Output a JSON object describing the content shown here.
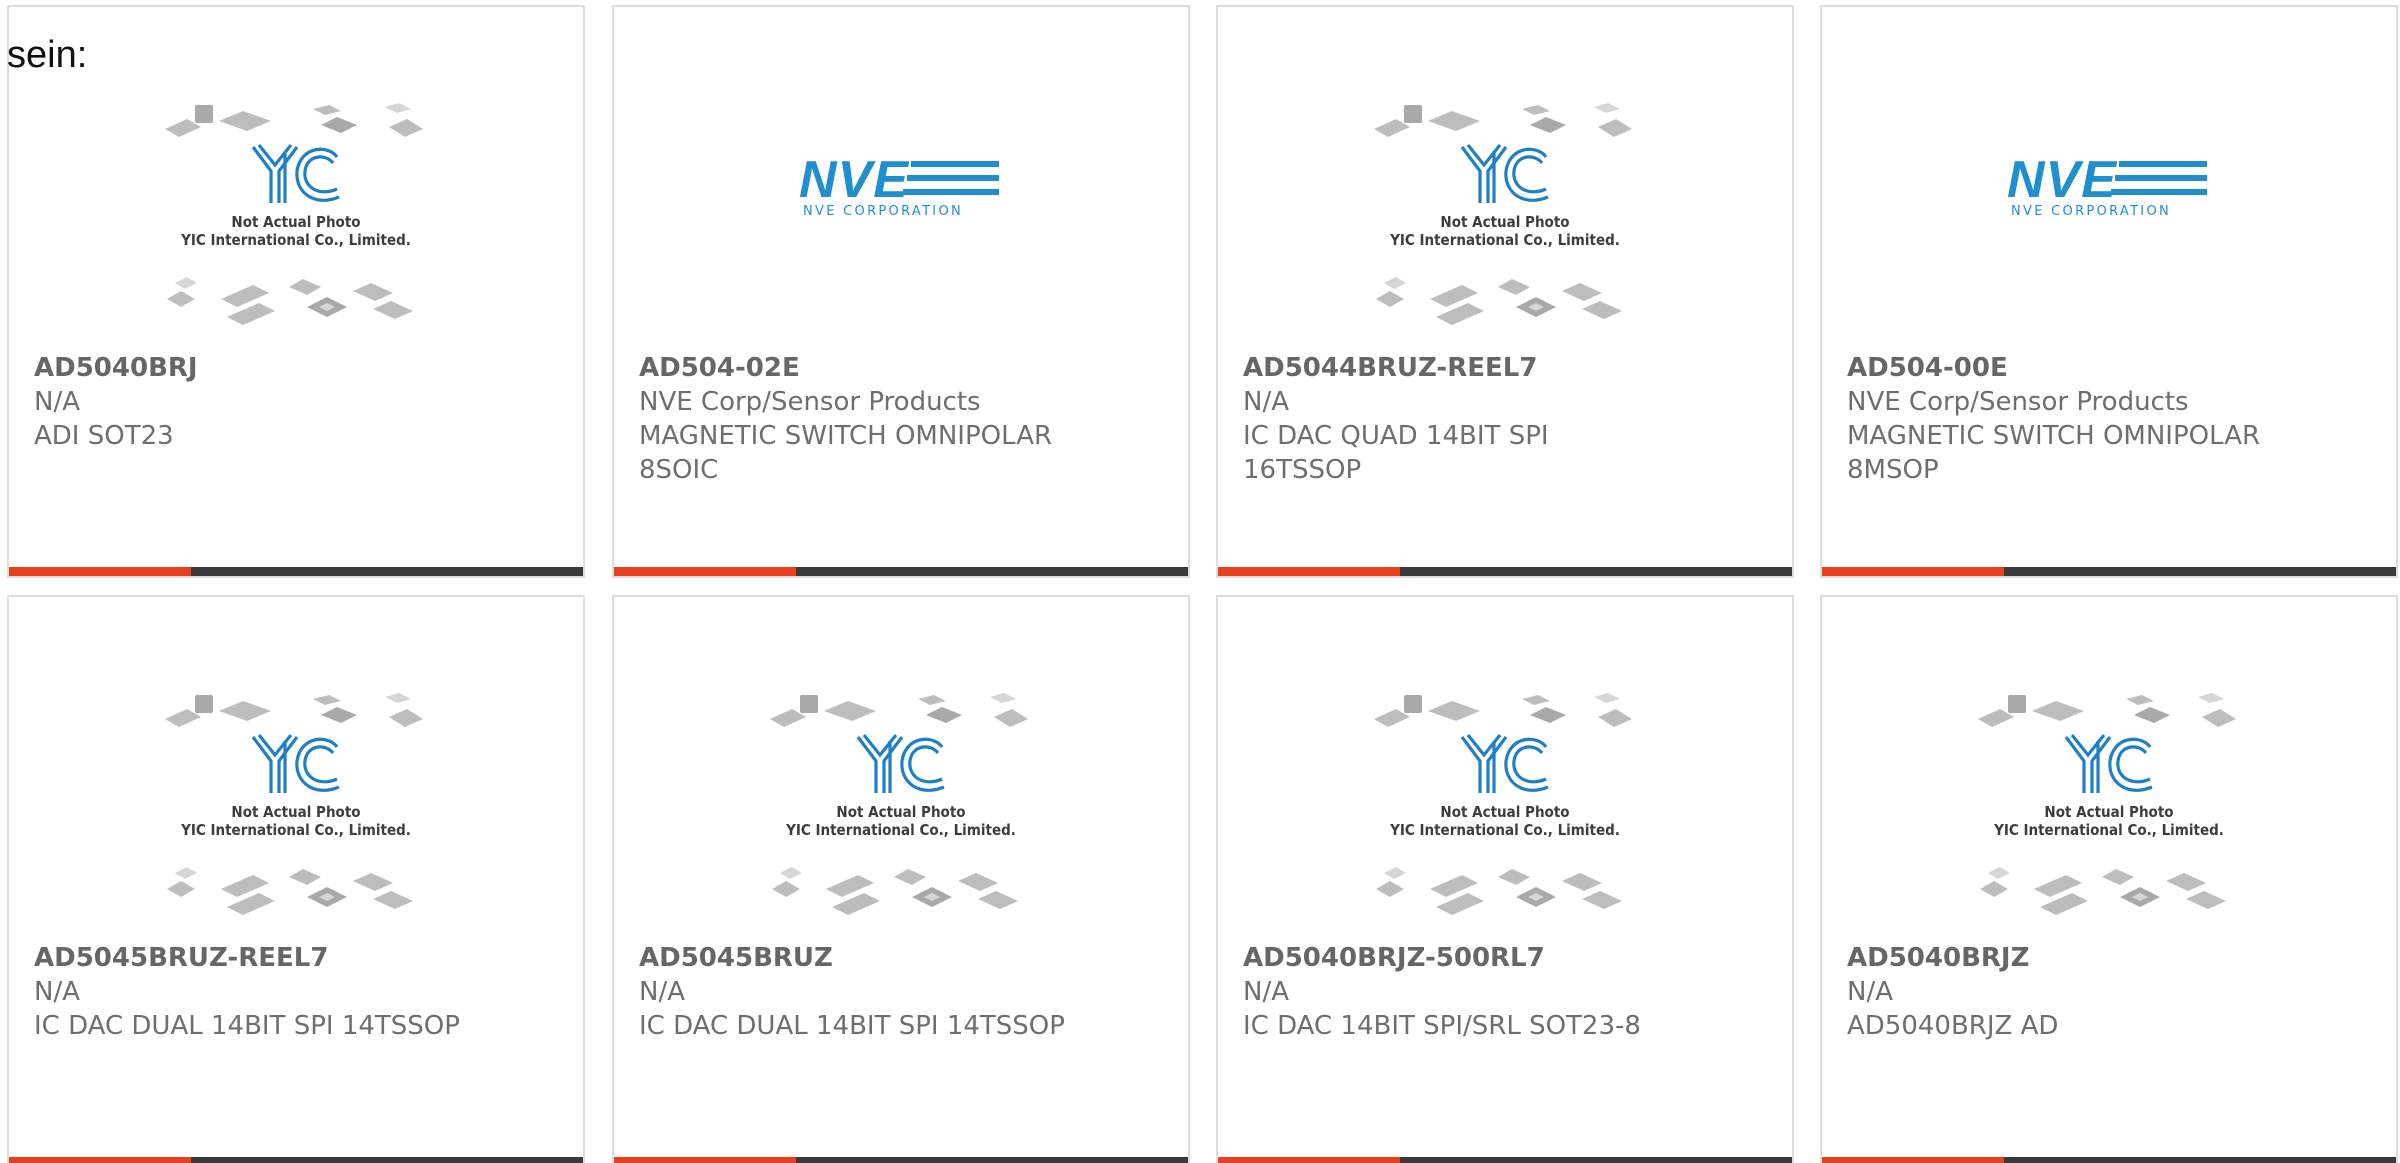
{
  "intro_text": "sein:",
  "placeholder": {
    "logo": "YIC",
    "note_line1": "Not Actual Photo",
    "note_line2": "YIC International Co., Limited."
  },
  "nve_logo": {
    "wordmark": "NVE",
    "subtitle": "NVE CORPORATION",
    "color": "#1f8fd0"
  },
  "colors": {
    "accent": "#e8401c",
    "bar": "#3a3a3a",
    "text": "#6e6e6e",
    "border": "#dcdcdc"
  },
  "products": [
    {
      "part": "AD5040BRJ",
      "brand": "N/A",
      "desc": "ADI SOT23",
      "desc2": "",
      "image": "yic-placeholder"
    },
    {
      "part": "AD504-02E",
      "brand": "NVE Corp/Sensor Products",
      "desc": "MAGNETIC SWITCH OMNIPOLAR",
      "desc2": "8SOIC",
      "image": "nve-logo"
    },
    {
      "part": "AD5044BRUZ-REEL7",
      "brand": "N/A",
      "desc": "IC DAC QUAD 14BIT SPI",
      "desc2": "16TSSOP",
      "image": "yic-placeholder"
    },
    {
      "part": "AD504-00E",
      "brand": "NVE Corp/Sensor Products",
      "desc": "MAGNETIC SWITCH OMNIPOLAR",
      "desc2": "8MSOP",
      "image": "nve-logo"
    },
    {
      "part": "AD5045BRUZ-REEL7",
      "brand": "N/A",
      "desc": "IC DAC DUAL 14BIT SPI 14TSSOP",
      "desc2": "",
      "image": "yic-placeholder"
    },
    {
      "part": "AD5045BRUZ",
      "brand": "N/A",
      "desc": "IC DAC DUAL 14BIT SPI 14TSSOP",
      "desc2": "",
      "image": "yic-placeholder"
    },
    {
      "part": "AD5040BRJZ-500RL7",
      "brand": "N/A",
      "desc": "IC DAC 14BIT SPI/SRL SOT23-8",
      "desc2": "",
      "image": "yic-placeholder"
    },
    {
      "part": "AD5040BRJZ",
      "brand": "N/A",
      "desc": "AD5040BRJZ AD",
      "desc2": "",
      "image": "yic-placeholder"
    }
  ]
}
